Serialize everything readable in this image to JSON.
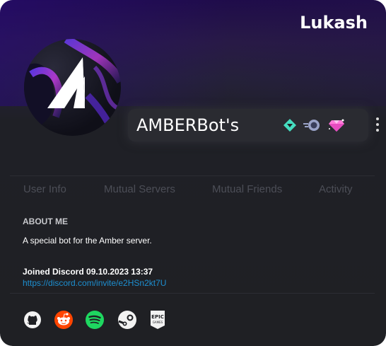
{
  "profile": {
    "owner_name": "Lukash",
    "bot_name": "AMBERBot's"
  },
  "badges": [
    "hypesquad-balance-icon",
    "nitro-icon",
    "gem-icon"
  ],
  "tabs": [
    {
      "label": "User Info"
    },
    {
      "label": "Mutual Servers"
    },
    {
      "label": "Mutual Friends"
    },
    {
      "label": "Activity"
    }
  ],
  "about": {
    "title": "ABOUT ME",
    "text": "A special bot for the Amber server.",
    "joined": "Joined Discord 09.10.2023  13:37",
    "invite": "https://discord.com/invite/e2HSn2kt7U"
  },
  "social": [
    "github-icon",
    "reddit-icon",
    "spotify-icon",
    "steam-icon",
    "epic-games-icon"
  ],
  "colors": {
    "link": "#1d8fd0",
    "reddit": "#ff4500",
    "spotify": "#1ed760",
    "tab_inactive": "#4c4e57"
  }
}
